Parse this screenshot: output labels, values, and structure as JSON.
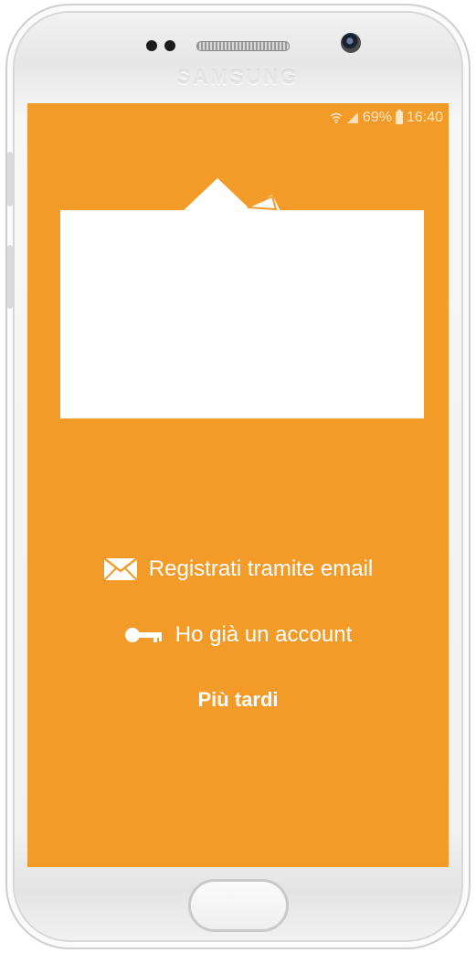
{
  "device": {
    "brand": "SAMSUNG"
  },
  "status_bar": {
    "battery_percent": "69%",
    "time": "16:40"
  },
  "colors": {
    "screen_bg": "#f29b29",
    "text": "#ffffff"
  },
  "actions": {
    "register_email": "Registrati tramite email",
    "have_account": "Ho già un account",
    "later": "Più tardi"
  },
  "icons": {
    "register_email": "envelope-icon",
    "have_account": "key-icon"
  }
}
